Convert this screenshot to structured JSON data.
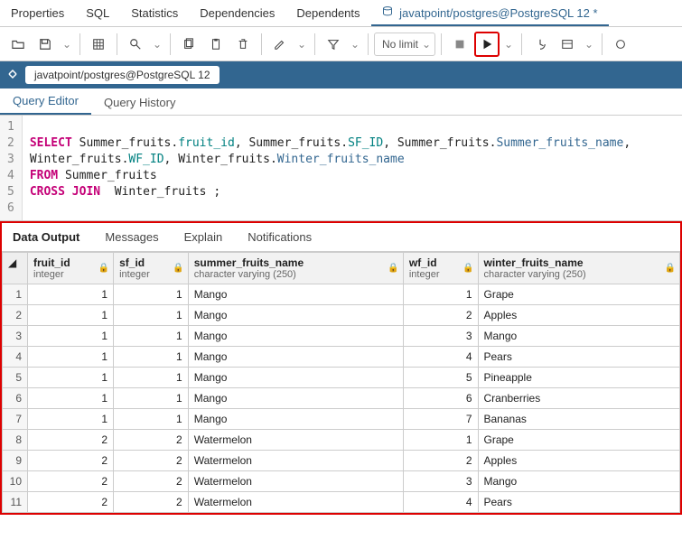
{
  "topTabs": {
    "properties": "Properties",
    "sql": "SQL",
    "statistics": "Statistics",
    "dependencies": "Dependencies",
    "dependents": "Dependents",
    "conn": "javatpoint/postgres@PostgreSQL 12 *"
  },
  "limit": "No limit",
  "breadcrumb": "javatpoint/postgres@PostgreSQL 12",
  "subTabs": {
    "editor": "Query Editor",
    "history": "Query History"
  },
  "code": {
    "lines": [
      "1",
      "2",
      "3",
      "4",
      "5",
      "6"
    ],
    "l2_select": "SELECT",
    "l2_a": " Summer_fruits.",
    "l2_fruitid": "fruit_id",
    "l2_b": ", Summer_fruits.",
    "l2_sfid": "SF_ID",
    "l2_c": ", Summer_fruits.",
    "l2_sfname": "Summer_fruits_name",
    "l2_d": ",",
    "l3_a": "Winter_fruits.",
    "l3_wfid": "WF_ID",
    "l3_b": ", Winter_fruits.",
    "l3_wfname": "Winter_fruits_name",
    "l4_from": "FROM",
    "l4_a": " Summer_fruits",
    "l5_cross": "CROSS",
    "l5_join": "JOIN",
    "l5_a": "  Winter_fruits ;"
  },
  "resultTabs": {
    "data": "Data Output",
    "messages": "Messages",
    "explain": "Explain",
    "notifications": "Notifications"
  },
  "cols": {
    "fruit_id_name": "fruit_id",
    "fruit_id_type": "integer",
    "sf_id_name": "sf_id",
    "sf_id_type": "integer",
    "sfn_name": "summer_fruits_name",
    "sfn_type": "character varying (250)",
    "wf_id_name": "wf_id",
    "wf_id_type": "integer",
    "wfn_name": "winter_fruits_name",
    "wfn_type": "character varying (250)"
  },
  "rows": [
    {
      "n": "1",
      "fruit_id": "1",
      "sf_id": "1",
      "sfn": "Mango",
      "wf_id": "1",
      "wfn": "Grape"
    },
    {
      "n": "2",
      "fruit_id": "1",
      "sf_id": "1",
      "sfn": "Mango",
      "wf_id": "2",
      "wfn": "Apples"
    },
    {
      "n": "3",
      "fruit_id": "1",
      "sf_id": "1",
      "sfn": "Mango",
      "wf_id": "3",
      "wfn": "Mango"
    },
    {
      "n": "4",
      "fruit_id": "1",
      "sf_id": "1",
      "sfn": "Mango",
      "wf_id": "4",
      "wfn": "Pears"
    },
    {
      "n": "5",
      "fruit_id": "1",
      "sf_id": "1",
      "sfn": "Mango",
      "wf_id": "5",
      "wfn": "Pineapple"
    },
    {
      "n": "6",
      "fruit_id": "1",
      "sf_id": "1",
      "sfn": "Mango",
      "wf_id": "6",
      "wfn": "Cranberries"
    },
    {
      "n": "7",
      "fruit_id": "1",
      "sf_id": "1",
      "sfn": "Mango",
      "wf_id": "7",
      "wfn": "Bananas"
    },
    {
      "n": "8",
      "fruit_id": "2",
      "sf_id": "2",
      "sfn": "Watermelon",
      "wf_id": "1",
      "wfn": "Grape"
    },
    {
      "n": "9",
      "fruit_id": "2",
      "sf_id": "2",
      "sfn": "Watermelon",
      "wf_id": "2",
      "wfn": "Apples"
    },
    {
      "n": "10",
      "fruit_id": "2",
      "sf_id": "2",
      "sfn": "Watermelon",
      "wf_id": "3",
      "wfn": "Mango"
    },
    {
      "n": "11",
      "fruit_id": "2",
      "sf_id": "2",
      "sfn": "Watermelon",
      "wf_id": "4",
      "wfn": "Pears"
    }
  ]
}
